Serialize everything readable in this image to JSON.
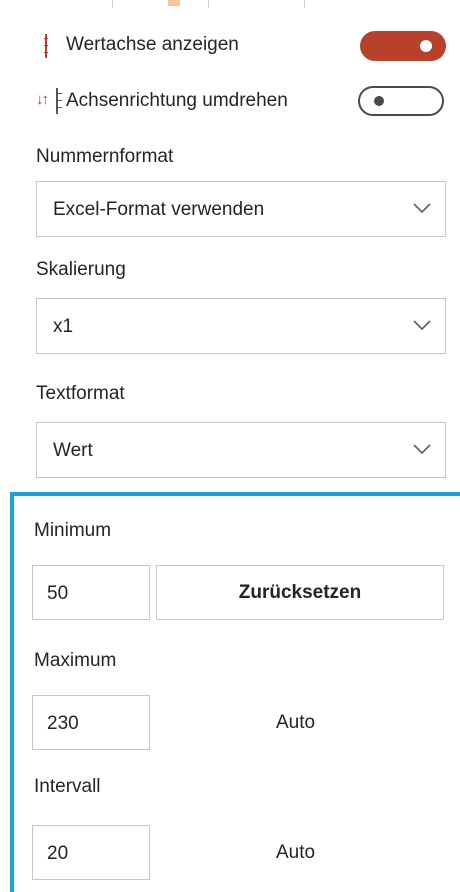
{
  "axis": {
    "show_axis_label": "Wertachse anzeigen",
    "show_axis_on": true,
    "reverse_label": "Achsenrichtung umdrehen",
    "reverse_on": false
  },
  "number_format": {
    "label": "Nummernformat",
    "value": "Excel-Format verwenden"
  },
  "scaling": {
    "label": "Skalierung",
    "value": "x1"
  },
  "text_format": {
    "label": "Textformat",
    "value": "Wert"
  },
  "minimum": {
    "label": "Minimum",
    "value": "50",
    "reset_label": "Zurücksetzen"
  },
  "maximum": {
    "label": "Maximum",
    "value": "230",
    "auto_label": "Auto"
  },
  "interval": {
    "label": "Intervall",
    "value": "20",
    "auto_label": "Auto"
  },
  "colors": {
    "toggle_on": "#b8412b",
    "accent_panel": "#1aa3d9",
    "icon_red": "#c0392b"
  }
}
